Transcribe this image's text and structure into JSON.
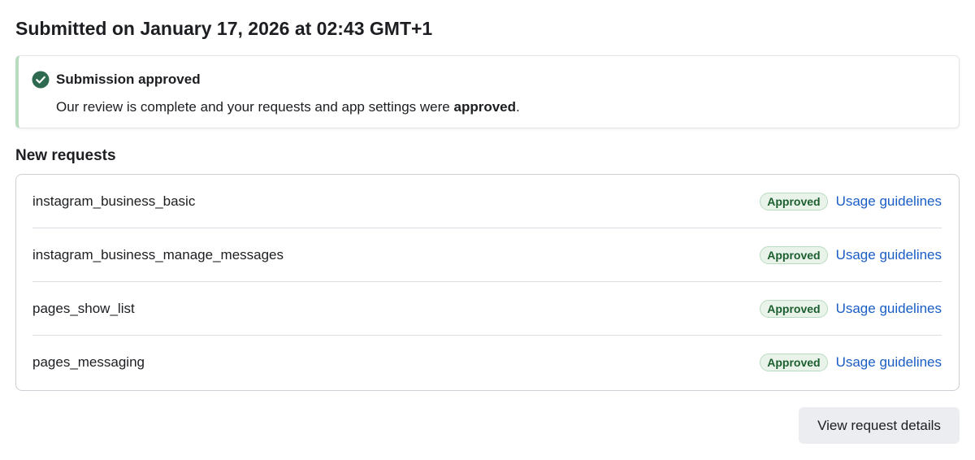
{
  "header": {
    "submitted_title": "Submitted on January 17, 2026 at 02:43 GMT+1"
  },
  "banner": {
    "icon": "check-circle-icon",
    "title": "Submission approved",
    "body_prefix": "Our review is complete and your requests and app settings were ",
    "body_emphasis": "approved",
    "body_suffix": ".",
    "accent_color": "#b9dcc0",
    "icon_color": "#2d6a4f"
  },
  "new_requests": {
    "title": "New requests",
    "items": [
      {
        "name": "instagram_business_basic",
        "status": "Approved",
        "link_label": "Usage guidelines"
      },
      {
        "name": "instagram_business_manage_messages",
        "status": "Approved",
        "link_label": "Usage guidelines"
      },
      {
        "name": "pages_show_list",
        "status": "Approved",
        "link_label": "Usage guidelines"
      },
      {
        "name": "pages_messaging",
        "status": "Approved",
        "link_label": "Usage guidelines"
      }
    ]
  },
  "footer": {
    "view_details_label": "View request details"
  },
  "colors": {
    "link": "#1a5dc5",
    "badge_text": "#1b5e2e",
    "badge_bg": "#e9f3ea",
    "button_bg": "#ebedf0"
  }
}
